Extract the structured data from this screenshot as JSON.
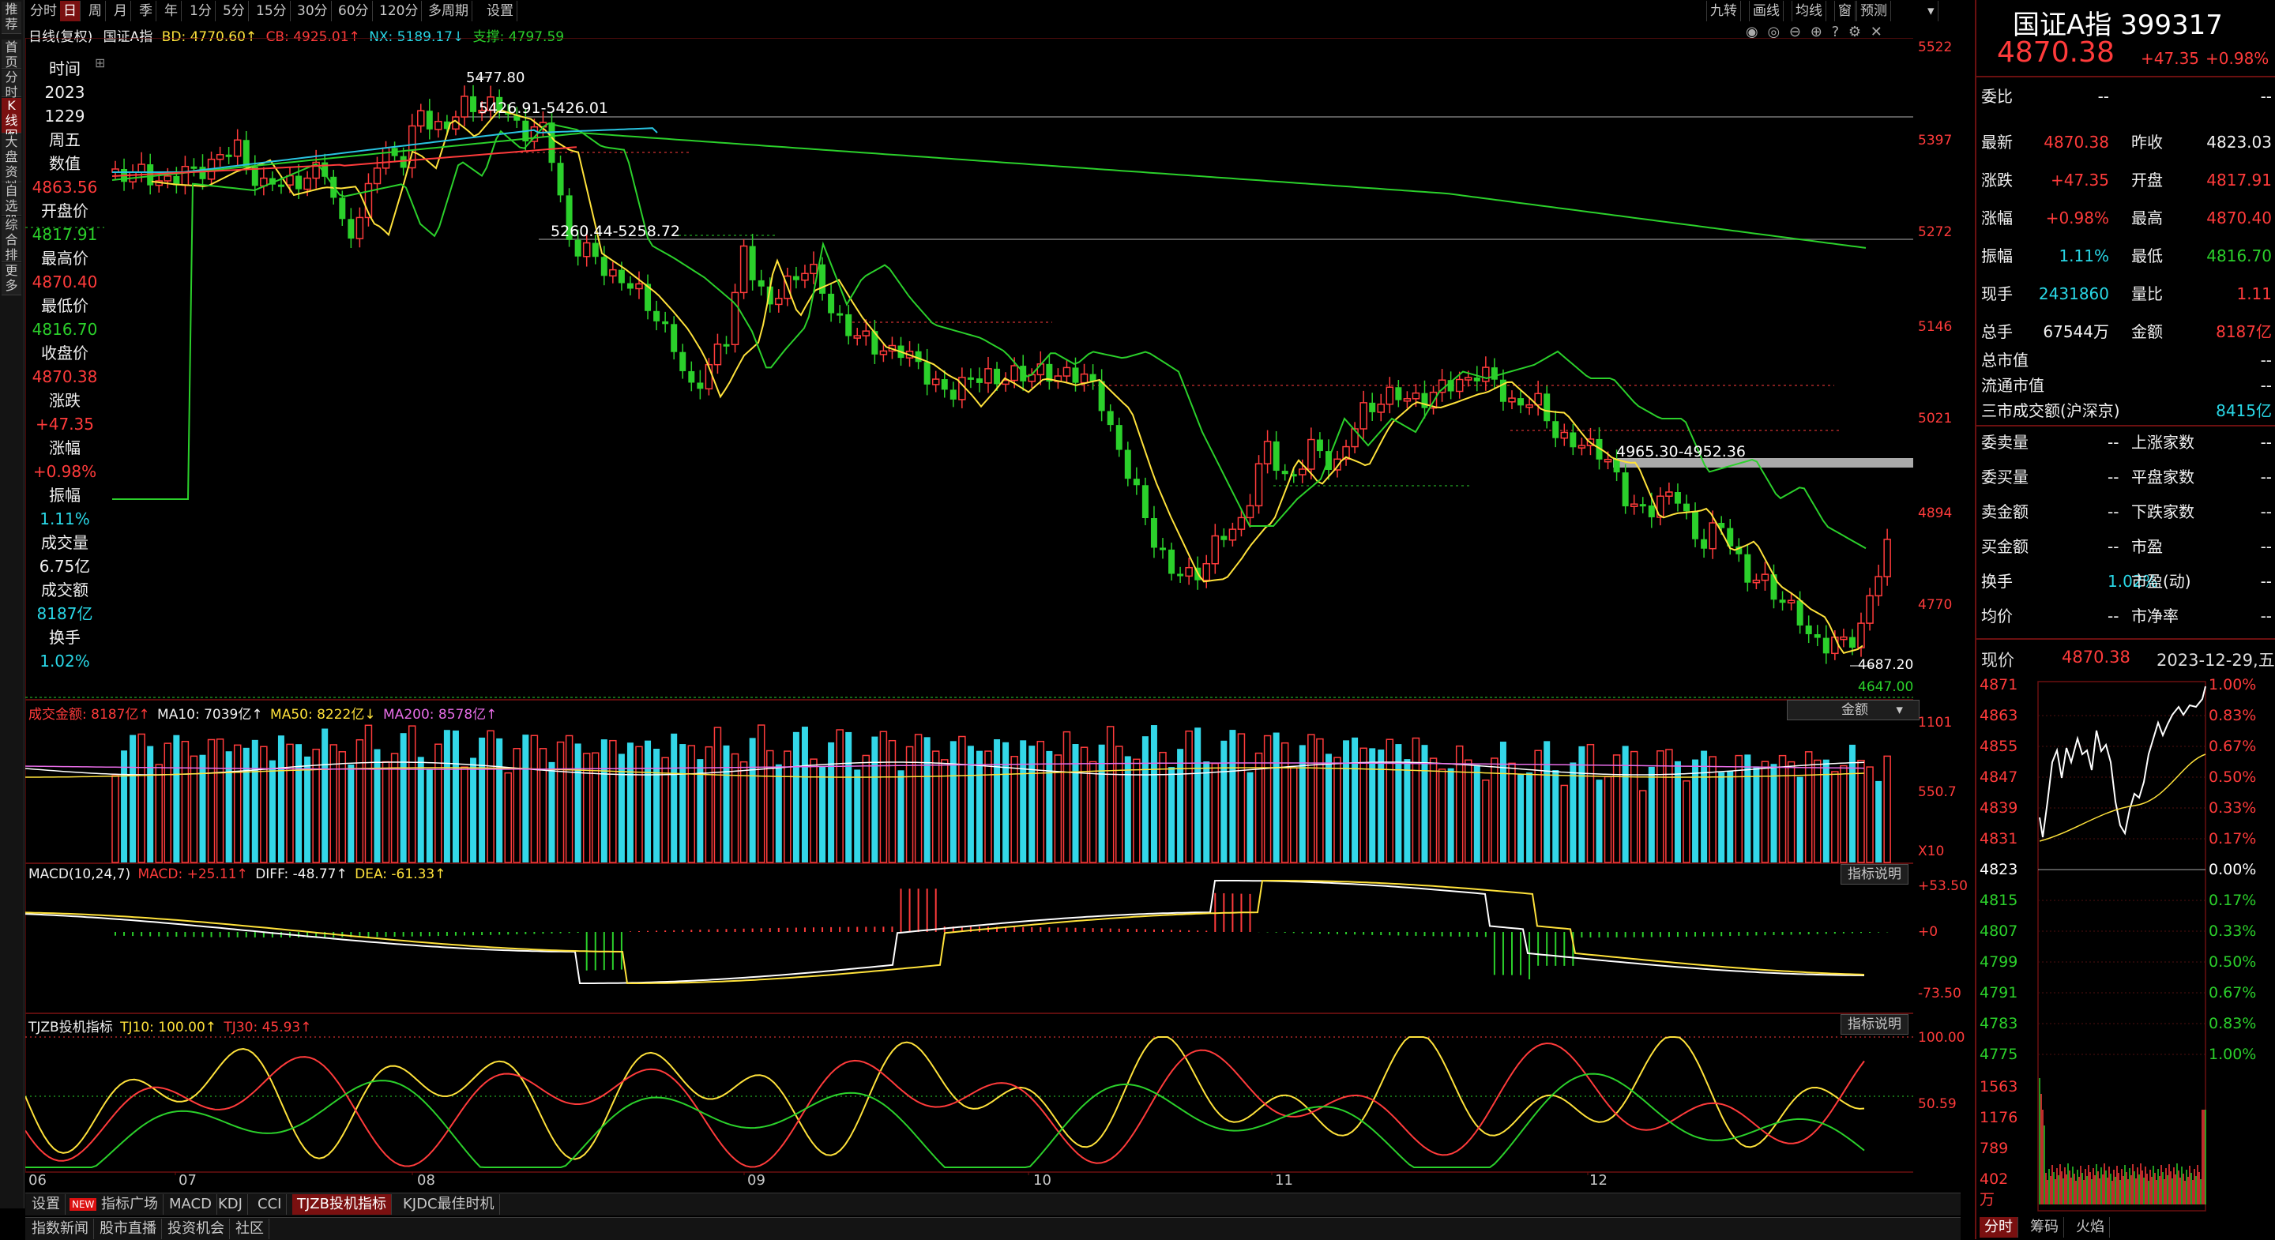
{
  "sidebar": {
    "items": [
      "推荐",
      "首页",
      "分时图",
      "K线图",
      "大盘资料",
      "自选股",
      "综合排名",
      "更多"
    ],
    "active": 3
  },
  "toolbar": {
    "periods": [
      "分时",
      "日",
      "周",
      "月",
      "季",
      "年",
      "1分",
      "5分",
      "15分",
      "30分",
      "60分",
      "120分",
      "多周期",
      "设置"
    ],
    "active": 1,
    "right_buttons": [
      "九转",
      "画线",
      "均线",
      "窗",
      "预测"
    ]
  },
  "chart_header": {
    "mode": "日线(复权)",
    "name": "国证A指",
    "bd": "BD: 4770.60↑",
    "cb": "CB: 4925.01↑",
    "nx": "NX: 5189.17↓",
    "support": "支撑: 4797.59"
  },
  "info_panel": [
    {
      "label": "时间",
      "value": "2023"
    },
    {
      "label": "",
      "value": "1229"
    },
    {
      "label": "周五",
      "value": ""
    },
    {
      "label": "数值",
      "value": "4863.56"
    },
    {
      "label": "开盘价",
      "value": "4817.91"
    },
    {
      "label": "最高价",
      "value": "4870.40"
    },
    {
      "label": "最低价",
      "value": "4816.70"
    },
    {
      "label": "收盘价",
      "value": "4870.38"
    },
    {
      "label": "涨跌",
      "value": "+47.35"
    },
    {
      "label": "涨幅",
      "value": "+0.98%"
    },
    {
      "label": "振幅",
      "value": "1.11%"
    },
    {
      "label": "成交量",
      "value": "6.75亿"
    },
    {
      "label": "成交额",
      "value": "8187亿"
    },
    {
      "label": "换手",
      "value": "1.02%"
    }
  ],
  "price_axis": [
    "5522",
    "5397",
    "5272",
    "5146",
    "5021",
    "4894",
    "4770"
  ],
  "annotations": {
    "high_peak": "5477.80",
    "range1": "5426.91-5426.01",
    "range2": "5260.44-5258.72",
    "range3": "4965.30-4952.36",
    "low1": "4687.20",
    "low2": "4647.00",
    "amount_btn": "金额"
  },
  "volume_header": {
    "label": "成交金额: 8187亿↑",
    "ma10": "MA10: 7039亿↑",
    "ma50": "MA50: 8222亿↓",
    "ma200": "MA200: 8578亿↑",
    "axis_top": "1101",
    "axis_mid": "550.7",
    "axis_unit": "X10"
  },
  "macd_header": {
    "label": "MACD(10,24,7)",
    "macd": "MACD: +25.11↑",
    "diff": "DIFF: -48.77↑",
    "dea": "DEA: -61.33↑",
    "btn": "指标说明",
    "axis_top": "+53.50",
    "axis_mid": "+0",
    "axis_bot": "-73.50"
  },
  "tjzb_header": {
    "label": "TJZB投机指标",
    "tj10": "TJ10: 100.00↑",
    "tj30": "TJ30: 45.93↑",
    "btn": "指标说明",
    "axis_top": "100.00",
    "axis_mid": "50.59"
  },
  "x_axis": [
    "06",
    "07",
    "08",
    "09",
    "10",
    "11",
    "12"
  ],
  "bottom_tabs_1": [
    "设置",
    "指标广场",
    "MACD",
    "KDJ",
    "CCI",
    "TJZB投机指标",
    "KJDC最佳时机"
  ],
  "bottom_tabs_1_active": 5,
  "bottom_new_badge": "NEW",
  "bottom_tabs_2": [
    "指数新闻",
    "股市直播",
    "投资机会",
    "社区"
  ],
  "right_panel": {
    "title": "国证A指 399317",
    "price": "4870.38",
    "change": "+47.35",
    "pct": "+0.98%",
    "rows": [
      {
        "l": "委比",
        "lv": "--",
        "r": "",
        "rv": "--"
      },
      {
        "l": "最新",
        "lv": "4870.38",
        "r": "昨收",
        "rv": "4823.03"
      },
      {
        "l": "涨跌",
        "lv": "+47.35",
        "r": "开盘",
        "rv": "4817.91"
      },
      {
        "l": "涨幅",
        "lv": "+0.98%",
        "r": "最高",
        "rv": "4870.40"
      },
      {
        "l": "振幅",
        "lv": "1.11%",
        "r": "最低",
        "rv": "4816.70"
      },
      {
        "l": "现手",
        "lv": "2431860",
        "r": "量比",
        "rv": "1.11"
      },
      {
        "l": "总手",
        "lv": "67544万",
        "r": "金额",
        "rv": "8187亿"
      }
    ],
    "rows2": [
      {
        "l": "总市值",
        "v": "--"
      },
      {
        "l": "流通市值",
        "v": "--"
      },
      {
        "l": "三市成交额(沪深京)",
        "v": "8415亿"
      }
    ],
    "rows3": [
      {
        "l": "委卖量",
        "lv": "--",
        "r": "上涨家数",
        "rv": "--"
      },
      {
        "l": "委买量",
        "lv": "--",
        "r": "平盘家数",
        "rv": "--"
      },
      {
        "l": "卖金额",
        "lv": "--",
        "r": "下跌家数",
        "rv": "--"
      },
      {
        "l": "买金额",
        "lv": "--",
        "r": "市盈",
        "rv": "--"
      },
      {
        "l": "换手",
        "lv": "1.02%",
        "r": "市盈(动)",
        "rv": "--"
      },
      {
        "l": "均价",
        "lv": "--",
        "r": "市净率",
        "rv": "--"
      }
    ],
    "now_label": "现价",
    "now_price": "4870.38",
    "now_date": "2023-12-29,五",
    "mini_left": [
      "4871",
      "4863",
      "4855",
      "4847",
      "4839",
      "4831",
      "4823",
      "4815",
      "4807",
      "4799",
      "4791",
      "4783",
      "4775",
      "1563",
      "1176",
      "789",
      "402",
      "万"
    ],
    "mini_right": [
      "1.00%",
      "0.83%",
      "0.67%",
      "0.50%",
      "0.33%",
      "0.17%",
      "0.00%",
      "0.17%",
      "0.33%",
      "0.50%",
      "0.67%",
      "0.83%",
      "1.00%"
    ],
    "bottom_tabs": [
      "分时",
      "筹码",
      "火焰"
    ]
  },
  "colors": {
    "up": "#ff3b3b",
    "down": "#2bd02b",
    "vol_down": "#33d7e8",
    "ma5": "#ffffff",
    "ma10": "#ffe23b",
    "ma20": "#2bd02b",
    "ma_long": "#29c3e0",
    "ma_long2": "#ff3b3b"
  }
}
